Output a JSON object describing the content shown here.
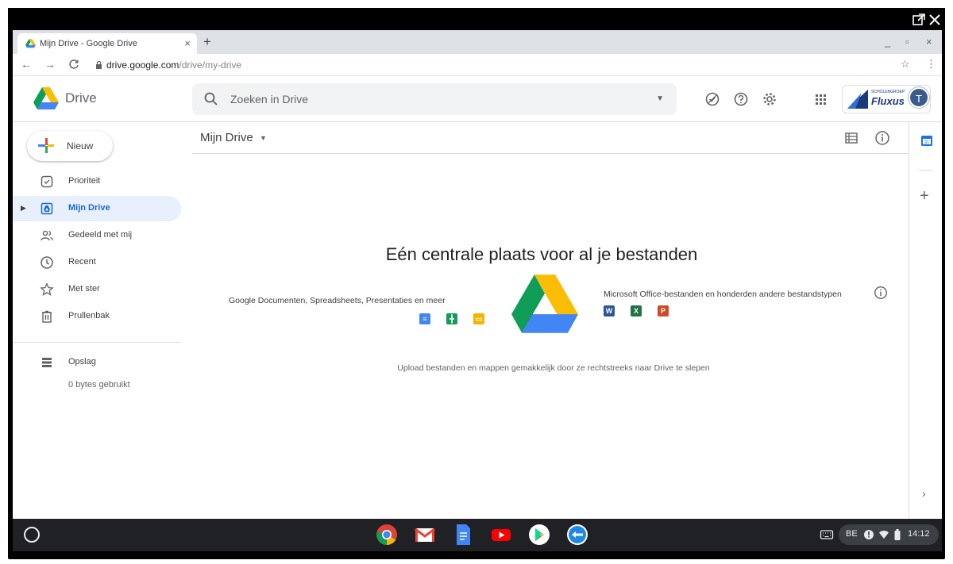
{
  "browser": {
    "tab_title": "Mijn Drive - Google Drive",
    "tab_close": "×",
    "new_tab": "+",
    "url_host": "drive.google.com",
    "url_path": "/drive/my-drive",
    "window_controls": [
      "_",
      "▫",
      "×"
    ]
  },
  "drive": {
    "product_name": "Drive",
    "search_placeholder": "Zoeken in Drive",
    "org_name": "Fluxus",
    "org_tagline": "SCHOLENGROEP",
    "avatar_initial": "T",
    "new_button": "Nieuw",
    "nav": [
      {
        "label": "Prioriteit",
        "icon": "priority-icon"
      },
      {
        "label": "Mijn Drive",
        "icon": "my-drive-icon",
        "active": true
      },
      {
        "label": "Gedeeld met mij",
        "icon": "shared-icon"
      },
      {
        "label": "Recent",
        "icon": "clock-icon"
      },
      {
        "label": "Met ster",
        "icon": "star-icon"
      },
      {
        "label": "Prullenbak",
        "icon": "trash-icon"
      }
    ],
    "storage": {
      "label": "Opslag",
      "used": "0 bytes gebruikt"
    },
    "breadcrumb": "Mijn Drive",
    "empty_state": {
      "title": "Eén centrale plaats voor al je bestanden",
      "left_caption": "Google Documenten, Spreadsheets, Presentaties en meer",
      "right_caption": "Microsoft Office-bestanden en honderden andere bestandstypen",
      "upload_hint": "Upload bestanden en mappen gemakkelijk door ze rechtstreeks naar Drive te slepen",
      "office_tiles": [
        "W",
        "X",
        "P"
      ]
    }
  },
  "shelf": {
    "language": "BE",
    "time": "14:12"
  },
  "colors": {
    "accent_blue": "#1967d2",
    "active_bg": "#e8f0fe",
    "docs_blue": "#4285f4",
    "sheets_green": "#0f9d58",
    "slides_yellow": "#f4b400",
    "word_blue": "#2b579a",
    "excel_green": "#217346",
    "ppt_orange": "#d24726"
  }
}
